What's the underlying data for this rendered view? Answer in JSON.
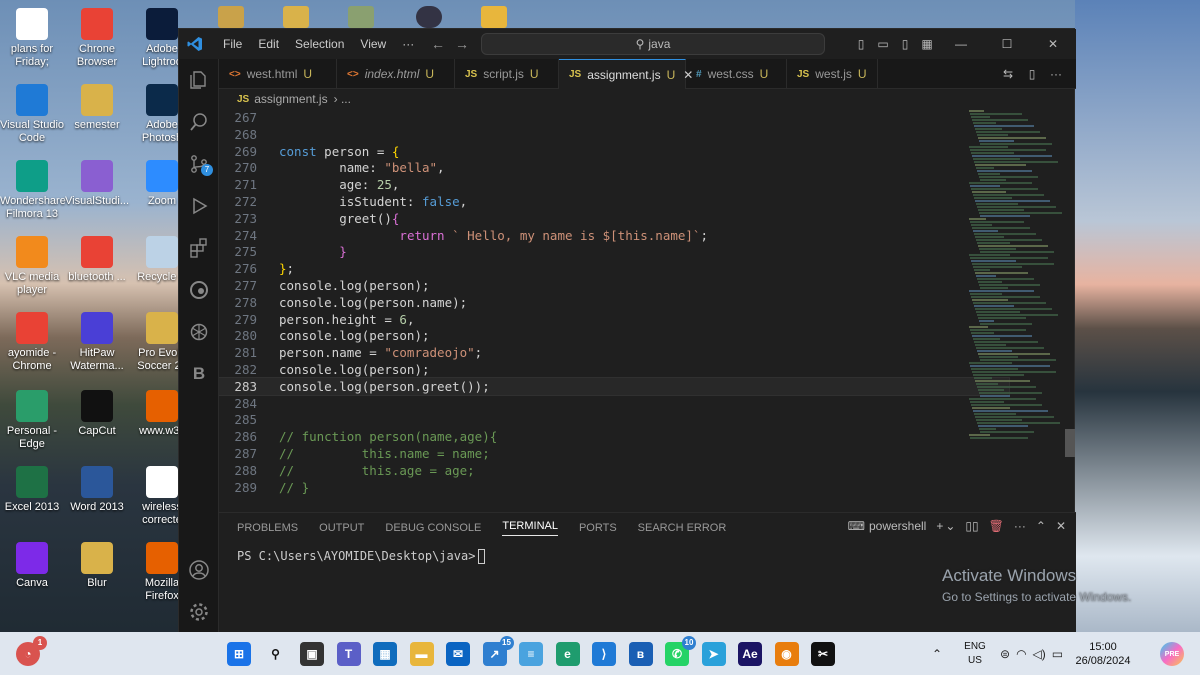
{
  "desktop": {
    "icons": [
      {
        "label": "plans for Friday;",
        "icon": "document-icon",
        "color": "#ffffff",
        "fg": "#333"
      },
      {
        "label": "Chrone Browser",
        "icon": "chrome-icon",
        "color": "#e94235"
      },
      {
        "label": "Adobe Lightroo",
        "icon": "lightroom-icon",
        "color": "#0b1c3a"
      },
      {
        "label": "Visual Studio Code",
        "icon": "vscode-icon",
        "color": "#1f7ad6"
      },
      {
        "label": "semester",
        "icon": "folder-icon",
        "color": "#d9b24a"
      },
      {
        "label": "Adobe Photosh",
        "icon": "photoshop-icon",
        "color": "#0b2a4a"
      },
      {
        "label": "Wondershare Filmora 13",
        "icon": "filmora-icon",
        "color": "#0e9e88"
      },
      {
        "label": "VisualStudi...",
        "icon": "visual-studio-icon",
        "color": "#8a5fd1"
      },
      {
        "label": "Zoom",
        "icon": "zoom-icon",
        "color": "#2d8cff"
      },
      {
        "label": "VLC media player",
        "icon": "vlc-icon",
        "color": "#f28a1c"
      },
      {
        "label": "bluetooth ...",
        "icon": "chrome-icon",
        "color": "#e94235"
      },
      {
        "label": "Recycle B",
        "icon": "recycle-bin-icon",
        "color": "#bcd2e6"
      },
      {
        "label": "ayomide - Chrome",
        "icon": "chrome-icon",
        "color": "#e94235"
      },
      {
        "label": "HitPaw Waterma...",
        "icon": "hitpaw-icon",
        "color": "#4a3fd6"
      },
      {
        "label": "Pro Evolu Soccer 20",
        "icon": "folder-icon",
        "color": "#d9b24a"
      },
      {
        "label": "Personal - Edge",
        "icon": "edge-icon",
        "color": "#2a9d6a"
      },
      {
        "label": "CapCut",
        "icon": "capcut-icon",
        "color": "#111111"
      },
      {
        "label": "www.w3s",
        "icon": "firefox-icon",
        "color": "#e66000"
      },
      {
        "label": "Excel 2013",
        "icon": "excel-icon",
        "color": "#1e7145"
      },
      {
        "label": "Word 2013",
        "icon": "word-icon",
        "color": "#2b579a"
      },
      {
        "label": "wireless correcte",
        "icon": "word-doc-icon",
        "color": "#ffffff"
      },
      {
        "label": "Canva",
        "icon": "canva-icon",
        "color": "#7d2ae8"
      },
      {
        "label": "Blur",
        "icon": "folder-icon",
        "color": "#d9b24a"
      },
      {
        "label": "Mozilla Firefox",
        "icon": "firefox-icon",
        "color": "#e66000"
      }
    ]
  },
  "window": {
    "menu": [
      "File",
      "Edit",
      "Selection",
      "View",
      "···"
    ],
    "search": "java",
    "tabs": [
      {
        "icon": "<>",
        "icon_color": "#e37933",
        "label": "west.html",
        "status": "U",
        "italic": false
      },
      {
        "icon": "<>",
        "icon_color": "#e37933",
        "label": "index.html",
        "status": "U",
        "italic": true
      },
      {
        "icon": "JS",
        "icon_color": "#d8c24e",
        "label": "script.js",
        "status": "U",
        "italic": false
      },
      {
        "icon": "JS",
        "icon_color": "#d8c24e",
        "label": "assignment.js",
        "status": "U",
        "italic": false,
        "active": true
      },
      {
        "icon": "#",
        "icon_color": "#519aba",
        "label": "west.css",
        "status": "U",
        "italic": false
      },
      {
        "icon": "JS",
        "icon_color": "#d8c24e",
        "label": "west.js",
        "status": "U",
        "italic": false
      }
    ],
    "breadcrumb": {
      "icon": "JS",
      "file": "assignment.js",
      "more": "›  ..."
    },
    "source_control_badge": "7"
  },
  "editor": {
    "current_line": 283,
    "lines": [
      {
        "n": 267,
        "parts": []
      },
      {
        "n": 268,
        "parts": []
      },
      {
        "n": 269,
        "parts": [
          [
            "kw",
            "const"
          ],
          [
            "plain",
            " person = "
          ],
          [
            "br",
            "{"
          ]
        ]
      },
      {
        "n": 270,
        "parts": [
          [
            "plain",
            "        name: "
          ],
          [
            "str",
            "\"bella\""
          ],
          [
            "plain",
            ","
          ]
        ]
      },
      {
        "n": 271,
        "parts": [
          [
            "plain",
            "        age: "
          ],
          [
            "num",
            "25"
          ],
          [
            "plain",
            ","
          ]
        ]
      },
      {
        "n": 272,
        "parts": [
          [
            "plain",
            "        isStudent: "
          ],
          [
            "kw",
            "false"
          ],
          [
            "plain",
            ","
          ]
        ]
      },
      {
        "n": 273,
        "parts": [
          [
            "plain",
            "        greet()"
          ],
          [
            "br2",
            "{"
          ]
        ]
      },
      {
        "n": 274,
        "parts": [
          [
            "plain",
            "                "
          ],
          [
            "br2",
            "return"
          ],
          [
            "str",
            " ` Hello, my name is $[this.name]`"
          ],
          [
            "plain",
            ";"
          ]
        ]
      },
      {
        "n": 275,
        "parts": [
          [
            "plain",
            "        "
          ],
          [
            "br2",
            "}"
          ]
        ]
      },
      {
        "n": 276,
        "parts": [
          [
            "br",
            "}"
          ],
          [
            "plain",
            ";"
          ]
        ]
      },
      {
        "n": 277,
        "parts": [
          [
            "plain",
            "console.log(person);"
          ]
        ]
      },
      {
        "n": 278,
        "parts": [
          [
            "plain",
            "console.log(person.name);"
          ]
        ]
      },
      {
        "n": 279,
        "parts": [
          [
            "plain",
            "person.height = "
          ],
          [
            "num",
            "6"
          ],
          [
            "plain",
            ","
          ]
        ]
      },
      {
        "n": 280,
        "parts": [
          [
            "plain",
            "console.log(person);"
          ]
        ]
      },
      {
        "n": 281,
        "parts": [
          [
            "plain",
            "person.name = "
          ],
          [
            "str",
            "\"comradeojo\""
          ],
          [
            "plain",
            ";"
          ]
        ]
      },
      {
        "n": 282,
        "parts": [
          [
            "plain",
            "console.log(person);"
          ]
        ]
      },
      {
        "n": 283,
        "parts": [
          [
            "plain",
            "console.log(person.greet());"
          ]
        ]
      },
      {
        "n": 284,
        "parts": []
      },
      {
        "n": 285,
        "parts": []
      },
      {
        "n": 286,
        "parts": [
          [
            "cm",
            "// function person(name,age){"
          ]
        ]
      },
      {
        "n": 287,
        "parts": [
          [
            "cm",
            "//         this.name = name;"
          ]
        ]
      },
      {
        "n": 288,
        "parts": [
          [
            "cm",
            "//         this.age = age;"
          ]
        ]
      },
      {
        "n": 289,
        "parts": [
          [
            "cm",
            "// }"
          ]
        ]
      }
    ]
  },
  "panel": {
    "tabs": [
      "PROBLEMS",
      "OUTPUT",
      "DEBUG CONSOLE",
      "TERMINAL",
      "PORTS",
      "SEARCH ERROR"
    ],
    "active_tab": "TERMINAL",
    "shell": "powershell",
    "prompt": "PS C:\\Users\\AYOMIDE\\Desktop\\java>"
  },
  "watermark": {
    "line1": "Activate Windows",
    "line2": "Go to Settings to activate Windows."
  },
  "taskbar": {
    "apps": [
      {
        "name": "windows-start-icon",
        "color": "#1a73e8",
        "glyph": "⊞"
      },
      {
        "name": "search-icon",
        "color": "transparent",
        "glyph": "⚲",
        "fg": "#111"
      },
      {
        "name": "task-view-icon",
        "color": "#333333",
        "glyph": "▣"
      },
      {
        "name": "teams-icon",
        "color": "#5b5fc7",
        "glyph": "T"
      },
      {
        "name": "store-icon",
        "color": "#0f6cbd",
        "glyph": "▦"
      },
      {
        "name": "file-explorer-icon",
        "color": "#e8b63c",
        "glyph": "▬"
      },
      {
        "name": "mail-icon",
        "color": "#0a64c2",
        "glyph": "✉"
      },
      {
        "name": "phone-link-icon",
        "color": "#2f7fd0",
        "glyph": "↗",
        "badge": "15"
      },
      {
        "name": "notepad-icon",
        "color": "#4aa3df",
        "glyph": "≡"
      },
      {
        "name": "edge-icon",
        "color": "#1f9c6e",
        "glyph": "e"
      },
      {
        "name": "vscode-icon",
        "color": "#1f7ad6",
        "glyph": "⟩"
      },
      {
        "name": "bluetooth-icon",
        "color": "#1a5fb4",
        "glyph": "ʙ"
      },
      {
        "name": "whatsapp-icon",
        "color": "#25d366",
        "glyph": "✆",
        "badge": "10"
      },
      {
        "name": "telegram-icon",
        "color": "#2aa1da",
        "glyph": "➤"
      },
      {
        "name": "after-effects-icon",
        "color": "#1b1464",
        "glyph": "Ae"
      },
      {
        "name": "blender-icon",
        "color": "#e87d0d",
        "glyph": "◉"
      },
      {
        "name": "capcut-icon",
        "color": "#111111",
        "glyph": "✂"
      }
    ],
    "notifications_badge": "1",
    "lang": {
      "line1": "ENG",
      "line2": "US"
    },
    "time": "15:00",
    "date": "26/08/2024"
  }
}
